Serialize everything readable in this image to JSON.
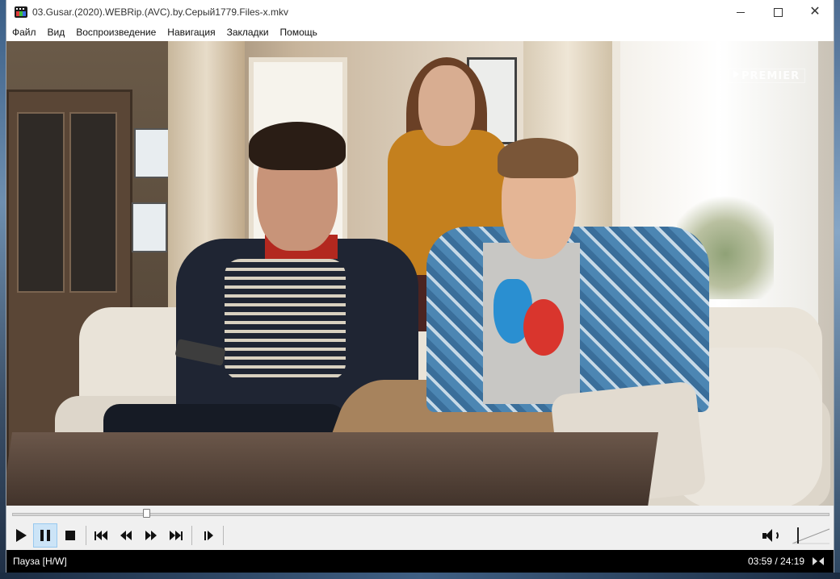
{
  "window": {
    "title": "03.Gusar.(2020).WEBRip.(AVC).by.Серый1779.Files-x.mkv"
  },
  "menu": {
    "items": [
      {
        "label": "Файл"
      },
      {
        "label": "Вид"
      },
      {
        "label": "Воспроизведение"
      },
      {
        "label": "Навигация"
      },
      {
        "label": "Закладки"
      },
      {
        "label": "Помощь"
      }
    ]
  },
  "video": {
    "watermark": "PREMIER"
  },
  "seek": {
    "position_fraction": 0.164
  },
  "controls": {
    "buttons": [
      {
        "name": "play-button",
        "icon": "play-icon",
        "active": false
      },
      {
        "name": "pause-button",
        "icon": "pause-icon",
        "active": true
      },
      {
        "name": "stop-button",
        "icon": "stop-icon",
        "active": false
      },
      {
        "name": "previous-button",
        "icon": "skip-previous-icon",
        "active": false
      },
      {
        "name": "rewind-button",
        "icon": "rewind-icon",
        "active": false
      },
      {
        "name": "fast-forward-button",
        "icon": "fast-forward-icon",
        "active": false
      },
      {
        "name": "next-button",
        "icon": "skip-next-icon",
        "active": false
      },
      {
        "name": "frame-step-button",
        "icon": "frame-step-icon",
        "active": false
      }
    ],
    "volume_icon": "speaker-icon",
    "volume_level": 0.15
  },
  "status": {
    "text": "Пауза [H/W]",
    "time": "03:59 / 24:19"
  },
  "colors": {
    "status_bar_bg": "#000000",
    "active_button_bg": "#cce4f7",
    "active_button_border": "#99c9ef"
  }
}
